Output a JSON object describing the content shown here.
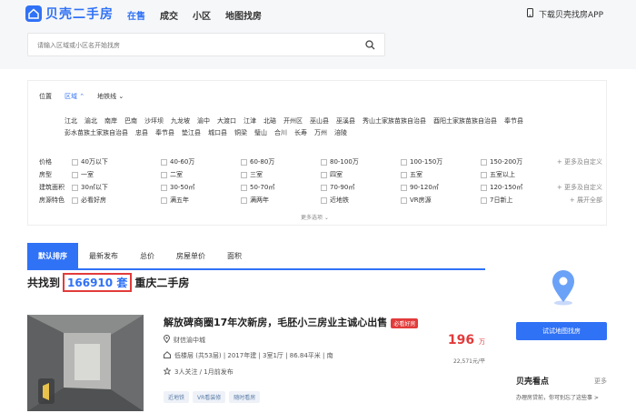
{
  "brand": {
    "name": "贝壳二手房",
    "color": "#3072f6"
  },
  "nav": {
    "items": [
      "在售",
      "成交",
      "小区",
      "地图找房"
    ],
    "active": "在售"
  },
  "app_download": "下载贝壳找房APP",
  "search": {
    "placeholder": "请输入区域或小区名开始找房"
  },
  "filter": {
    "position_label": "位置",
    "position_tabs": [
      "区域",
      "地铁线"
    ],
    "districts": [
      "江北",
      "渝北",
      "南岸",
      "巴南",
      "沙坪坝",
      "九龙坡",
      "渝中",
      "大渡口",
      "江津",
      "北碚",
      "开州区",
      "巫山县",
      "巫溪县",
      "秀山土家族苗族自治县",
      "酉阳土家族苗族自治县",
      "奉节县",
      "彭水苗族土家族自治县",
      "忠县",
      "奉节县",
      "垫江县",
      "城口县",
      "铜梁",
      "璧山",
      "合川",
      "长寿",
      "万州",
      "涪陵"
    ],
    "rows": [
      {
        "label": "价格",
        "options": [
          "40万以下",
          "40-60万",
          "60-80万",
          "80-100万",
          "100-150万",
          "150-200万"
        ],
        "extra": "更多及自定义"
      },
      {
        "label": "房型",
        "options": [
          "一室",
          "二室",
          "三室",
          "四室",
          "五室",
          "五室以上"
        ],
        "extra": ""
      },
      {
        "label": "建筑面积",
        "options": [
          "30㎡以下",
          "30-50㎡",
          "50-70㎡",
          "70-90㎡",
          "90-120㎡",
          "120-150㎡"
        ],
        "extra": "更多及自定义"
      },
      {
        "label": "房源特色",
        "options": [
          "必看好房",
          "满五年",
          "满两年",
          "近地铁",
          "VR房源",
          "7日新上"
        ],
        "extra": "展开全部"
      }
    ],
    "more_options": "更多选项"
  },
  "sort_tabs": [
    "默认排序",
    "最新发布",
    "总价",
    "房屋单价",
    "面积"
  ],
  "result": {
    "prefix": "共找到",
    "count": "166910",
    "suffix": "套",
    "tail": "重庆二手房"
  },
  "listing": {
    "title": "解放碑商圈17年次新房，毛胚小三房业主诚心出售",
    "badge": "必看好房",
    "location": "财信渝中城",
    "info": "低楼层 (共53层) | 2017年建 | 3室1厅 | 86.84平米 | 南",
    "follow": "3人关注 / 1月前发布",
    "tags": [
      "近地铁",
      "VR看装修",
      "随时看房"
    ],
    "price": "196",
    "price_unit": "万",
    "unit_price": "22,571元/平"
  },
  "side": {
    "map_button": "试试地图找房",
    "kanpan_title": "贝壳看点",
    "kanpan_more": "更多",
    "kanpan_text": "办理房贷前，你可别忘了这些事 >"
  },
  "accent_red": "#e23b3b"
}
